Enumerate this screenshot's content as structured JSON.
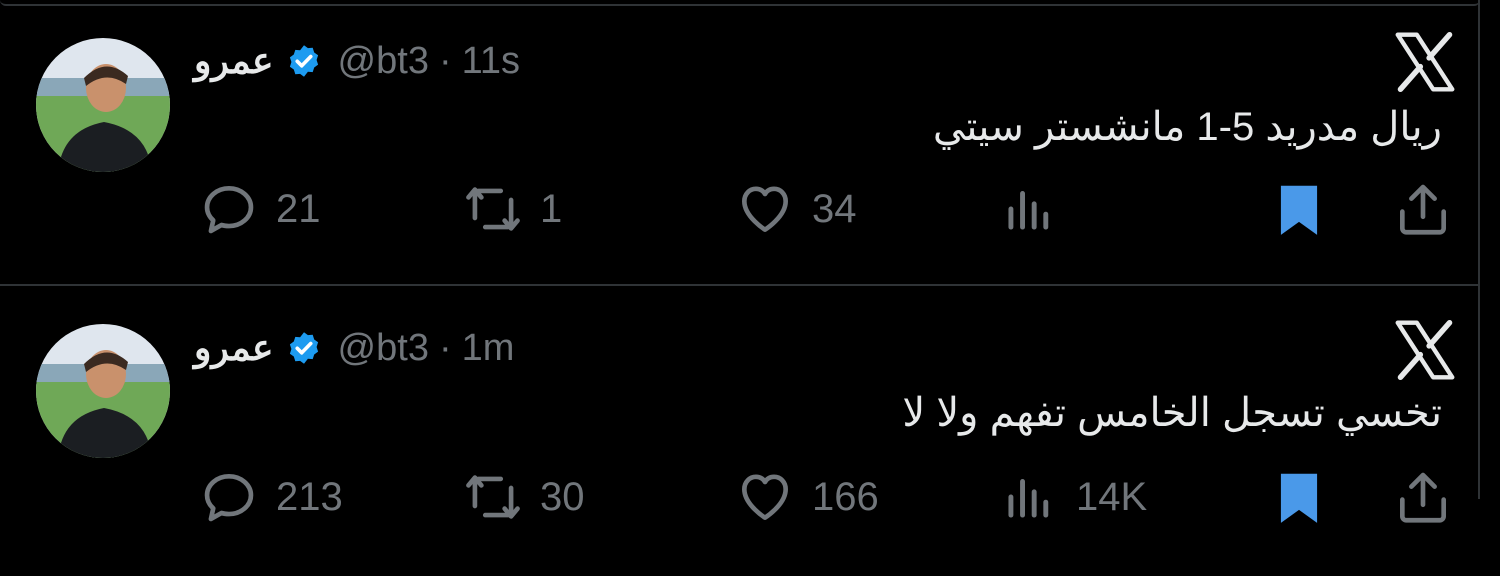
{
  "tweets": [
    {
      "name": "عمرو",
      "handle": "@bt3",
      "separator": "·",
      "time": "11s",
      "text": "ريال مدريد 5-1 مانشستر سيتي",
      "replies": "21",
      "retweets": "1",
      "likes": "34",
      "views": "",
      "bookmarked": true
    },
    {
      "name": "عمرو",
      "handle": "@bt3",
      "separator": "·",
      "time": "1m",
      "text": "تخسي تسجل الخامس تفهم ولا لا",
      "replies": "213",
      "retweets": "30",
      "likes": "166",
      "views": "14K",
      "bookmarked": true
    }
  ],
  "icons": {
    "verified": "verified-badge-icon",
    "platform": "x-logo-icon",
    "reply": "reply-icon",
    "retweet": "retweet-icon",
    "like": "heart-icon",
    "views": "views-icon",
    "bookmark": "bookmark-icon",
    "share": "share-icon"
  },
  "colors": {
    "background": "#000000",
    "text": "#e7e9ea",
    "muted": "#71767b",
    "accent": "#1d9bf0",
    "bookmark": "#4a99e9",
    "divider": "#2f3336"
  }
}
